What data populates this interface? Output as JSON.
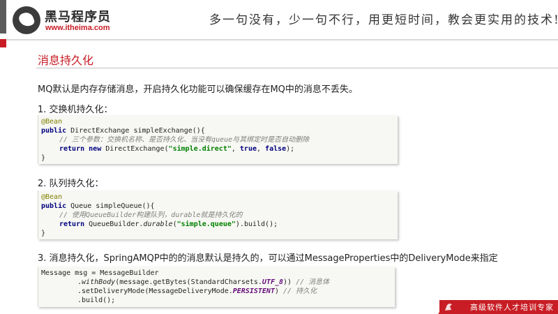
{
  "header": {
    "logo_text": "黑马程序员",
    "logo_url": "www.itheima.com",
    "slogan": "多一句没有，少一句不行，用更短时间，教会更实用的技术!"
  },
  "title": "消息持久化",
  "intro": "MQ默认是内存存储消息，开启持久化功能可以确保缓存在MQ中的消息不丢失。",
  "steps": [
    {
      "label": "1.  交换机持久化："
    },
    {
      "label": "2.  队列持久化："
    },
    {
      "label": "3.  消息持久化，SpringAMQP中的的消息默认是持久的，可以通过MessageProperties中的DeliveryMode来指定"
    }
  ],
  "code1": {
    "annotation": "@Bean",
    "kw_public": "public",
    "sig": " DirectExchange simpleExchange(){",
    "comment": "// 三个参数：交换机名称、是否持久化、当没有queue与其绑定时是否自动删除",
    "kw_return": "return",
    "kw_new": "new",
    "ctor": " DirectExchange(",
    "str": "\"simple.direct\"",
    "sep1": ", ",
    "kw_true": "true",
    "sep2": ", ",
    "kw_false": "false",
    "end": ");",
    "close": "}"
  },
  "code2": {
    "annotation": "@Bean",
    "kw_public": "public",
    "sig": " Queue simpleQueue(){",
    "comment": "// 使用QueueBuilder构建队列，durable就是持久化的",
    "kw_return": "return",
    "builder": " QueueBuilder.",
    "method": "durable",
    "open": "(",
    "str": "\"simple.queue\"",
    "end": ").build();",
    "close": "}"
  },
  "code3": {
    "l1": "Message msg = MessageBuilder",
    "l2_dot": ".",
    "l2_method": "withBody",
    "l2_rest": "(message.getBytes(StandardCharsets.",
    "l2_const": "UTF_8",
    "l2_end": ")) ",
    "l2_comment": "// 消息体",
    "l3_a": ".setDeliveryMode(MessageDeliveryMode.",
    "l3_const": "PERSISTENT",
    "l3_end": ") ",
    "l3_comment": "// 持久化",
    "l4": ".build();"
  },
  "footer": {
    "text": "高级软件人才培训专家"
  },
  "colors": {
    "brand_red": "#c81d25",
    "code_bg": "#f7f8f3"
  }
}
